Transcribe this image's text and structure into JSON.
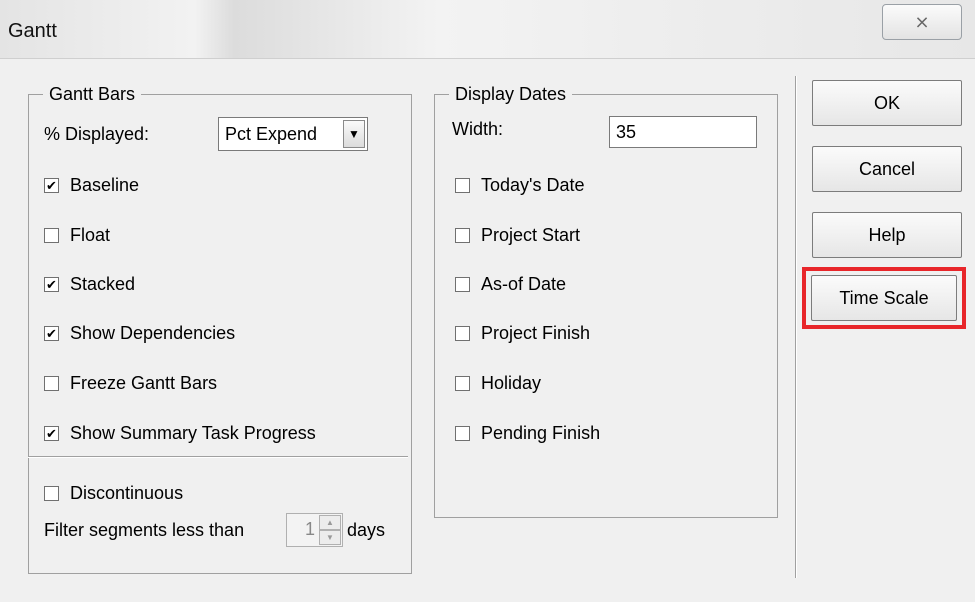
{
  "window": {
    "title": "Gantt",
    "close_symbol": "⨯"
  },
  "gantt_bars": {
    "legend": "Gantt Bars",
    "pct_label": "% Displayed:",
    "pct_select_value": "Pct Expend",
    "checkboxes": [
      {
        "label": "Baseline",
        "checked": true
      },
      {
        "label": "Float",
        "checked": false
      },
      {
        "label": "Stacked",
        "checked": true
      },
      {
        "label": "Show Dependencies",
        "checked": true
      },
      {
        "label": "Freeze Gantt Bars",
        "checked": false
      },
      {
        "label": "Show Summary Task Progress",
        "checked": true
      }
    ],
    "discontinuous": {
      "label": "Discontinuous",
      "checked": false
    },
    "filter_label": "Filter segments less than",
    "filter_value": "1",
    "filter_unit": "days"
  },
  "display_dates": {
    "legend": "Display Dates",
    "width_label": "Width:",
    "width_value": "35",
    "checkboxes": [
      {
        "label": "Today's Date",
        "checked": false
      },
      {
        "label": "Project Start",
        "checked": false
      },
      {
        "label": "As-of Date",
        "checked": false
      },
      {
        "label": "Project Finish",
        "checked": false
      },
      {
        "label": "Holiday",
        "checked": false
      },
      {
        "label": "Pending Finish",
        "checked": false
      }
    ]
  },
  "buttons": {
    "ok": "OK",
    "cancel": "Cancel",
    "help": "Help",
    "time_scale": "Time Scale"
  },
  "colors": {
    "highlight": "#e8262a",
    "dialog_bg": "#f0f0f0"
  }
}
